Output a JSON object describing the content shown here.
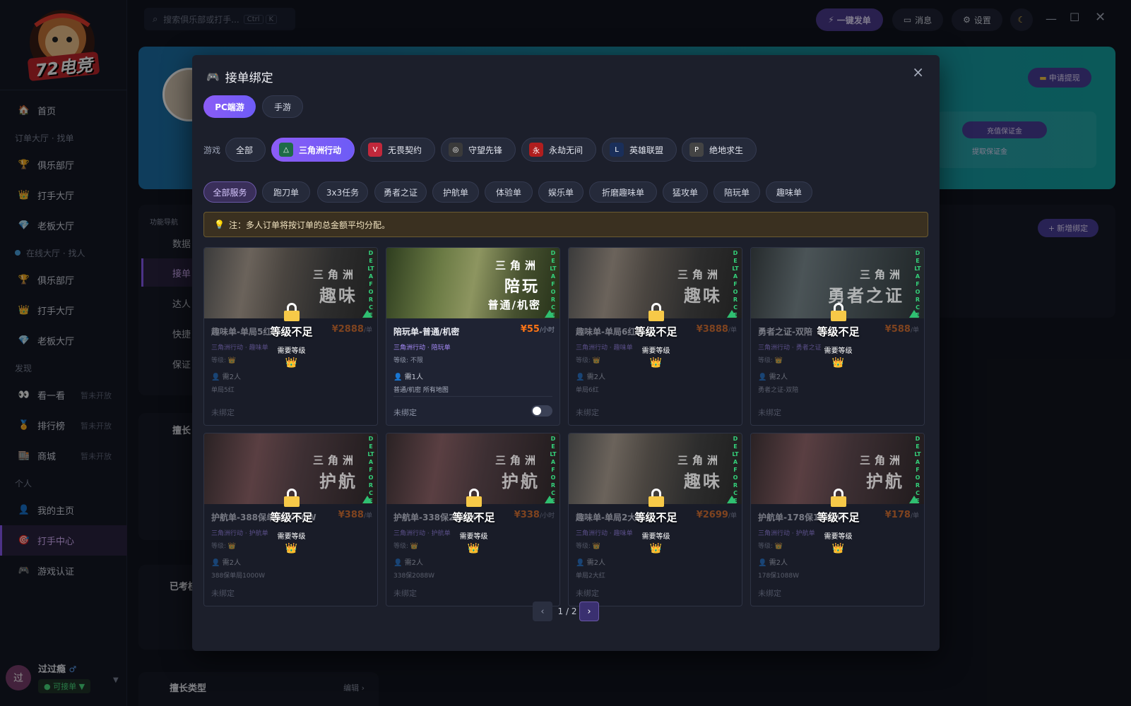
{
  "sidebar": {
    "logo_text": "72电竞",
    "sections": [
      {
        "type": "item",
        "icon": "🏠",
        "label": "首页",
        "name": "home"
      },
      {
        "type": "section",
        "label": "订单大厅 · 找单"
      },
      {
        "type": "item",
        "icon": "🏆",
        "label": "俱乐部厅",
        "name": "club-hall-orders"
      },
      {
        "type": "item",
        "icon": "👑",
        "label": "打手大厅",
        "name": "player-hall-orders"
      },
      {
        "type": "item",
        "icon": "💎",
        "label": "老板大厅",
        "name": "boss-hall-orders"
      },
      {
        "type": "section",
        "label": "在线大厅 · 找人",
        "dot": true
      },
      {
        "type": "item",
        "icon": "🏆",
        "label": "俱乐部厅",
        "name": "club-hall-online"
      },
      {
        "type": "item",
        "icon": "👑",
        "label": "打手大厅",
        "name": "player-hall-online"
      },
      {
        "type": "item",
        "icon": "💎",
        "label": "老板大厅",
        "name": "boss-hall-online"
      },
      {
        "type": "section",
        "label": "发现"
      },
      {
        "type": "item",
        "icon": "👀",
        "label": "看一看",
        "soon": "暂未开放",
        "name": "browse"
      },
      {
        "type": "item",
        "icon": "🏅",
        "label": "排行榜",
        "soon": "暂未开放",
        "name": "ranking"
      },
      {
        "type": "item",
        "icon": "🏬",
        "label": "商城",
        "soon": "暂未开放",
        "name": "mall"
      },
      {
        "type": "section",
        "label": "个人"
      },
      {
        "type": "item",
        "icon": "👤",
        "label": "我的主页",
        "name": "my-home"
      },
      {
        "type": "item",
        "icon": "🎯",
        "label": "打手中心",
        "active": true,
        "name": "player-center"
      },
      {
        "type": "item",
        "icon": "🎮",
        "label": "游戏认证",
        "name": "game-auth"
      }
    ],
    "user": {
      "avatar": "过",
      "name": "过过瘾",
      "gender": "♂",
      "status": "● 可接单 ▼"
    }
  },
  "topbar": {
    "search_placeholder": "搜索俱乐部或打手...",
    "shortcut": [
      "Ctrl",
      "K"
    ],
    "quick_order": "一键发单",
    "messages": "消息",
    "settings": "设置"
  },
  "background": {
    "apply_withdraw": "申请提现",
    "recharge_deposit": "充值保证金",
    "withdraw_deposit": "提取保证金",
    "function_nav": "功能导航",
    "nav_items": [
      "数据",
      "接单",
      "达人",
      "快捷",
      "保证"
    ],
    "add_binding": "新增绑定",
    "skills_title": "擅长",
    "passed_title": "已考核",
    "skill_types": "擅长类型",
    "edit": "编辑 ›"
  },
  "modal": {
    "title": "接单绑定",
    "platforms": [
      "PC端游",
      "手游"
    ],
    "game_label": "游戏",
    "games": [
      {
        "label": "全部",
        "icon": "",
        "name": "all"
      },
      {
        "label": "三角洲行动",
        "icon": "△",
        "color": "#1e6b47",
        "active": true,
        "name": "delta-force"
      },
      {
        "label": "无畏契约",
        "icon": "V",
        "color": "#c2283b",
        "name": "valorant"
      },
      {
        "label": "守望先锋",
        "icon": "◎",
        "color": "#3a3a3a",
        "name": "overwatch"
      },
      {
        "label": "永劫无间",
        "icon": "永",
        "color": "#b01e1e",
        "name": "naraka"
      },
      {
        "label": "英雄联盟",
        "icon": "L",
        "color": "#1a2f5a",
        "name": "lol"
      },
      {
        "label": "绝地求生",
        "icon": "P",
        "color": "#444444",
        "name": "pubg"
      }
    ],
    "services": [
      "全部服务",
      "跑刀单",
      "3x3任务",
      "勇者之证",
      "护航单",
      "体验单",
      "娱乐单",
      "折磨趣味单",
      "猛攻单",
      "陪玩单",
      "趣味单"
    ],
    "note": "注：多人订单将按订单的总金额平均分配。",
    "lock_title": "等级不足",
    "lock_sub": "需要等级",
    "lock_crown": "👑",
    "cards": [
      {
        "b_top": "三角洲",
        "b_big": "趣味",
        "b_sub": "",
        "name": "趣味单-单局5红",
        "price": "¥2888",
        "unit": "/单",
        "tags": "三角洲行动 · 趣味单",
        "level": "等级: 👑",
        "people": "需2人",
        "desc": "单局5红",
        "bind": "未绑定",
        "locked": true,
        "art": "a"
      },
      {
        "b_top": "三角洲",
        "b_big": "陪玩",
        "b_sub": "普通/机密",
        "name": "陪玩单-普通/机密",
        "price": "¥55",
        "unit": "/小时",
        "tags": "三角洲行动 · 陪玩单",
        "level": "等级: 不限",
        "people": "需1人",
        "desc": "普通/机密 所有地图",
        "bind": "未绑定",
        "locked": false,
        "art": "b"
      },
      {
        "b_top": "三角洲",
        "b_big": "趣味",
        "b_sub": "",
        "name": "趣味单-单局6红",
        "price": "¥3888",
        "unit": "/单",
        "tags": "三角洲行动 · 趣味单",
        "level": "等级: 👑",
        "people": "需2人",
        "desc": "单局6红",
        "bind": "未绑定",
        "locked": true,
        "art": "a"
      },
      {
        "b_top": "三角洲",
        "b_big": "勇者之证",
        "b_sub": "",
        "name": "勇者之证-双陪",
        "price": "¥588",
        "unit": "/单",
        "tags": "三角洲行动 · 勇者之证",
        "level": "等级: 👑",
        "people": "需2人",
        "desc": "勇者之证-双陪",
        "bind": "未绑定",
        "locked": true,
        "art": "c"
      },
      {
        "b_top": "三角洲",
        "b_big": "护航",
        "b_sub": "",
        "name": "护航单-388保单局1000W",
        "price": "¥388",
        "unit": "/单",
        "tags": "三角洲行动 · 护航单",
        "level": "等级: 👑",
        "people": "需2人",
        "desc": "388保单局1000W",
        "bind": "未绑定",
        "locked": true,
        "art": "d"
      },
      {
        "b_top": "三角洲",
        "b_big": "护航",
        "b_sub": "",
        "name": "护航单-338保2088W",
        "price": "¥338",
        "unit": "/小时",
        "tags": "三角洲行动 · 护航单",
        "level": "等级: 👑",
        "people": "需2人",
        "desc": "338保2088W",
        "bind": "未绑定",
        "locked": true,
        "art": "d"
      },
      {
        "b_top": "三角洲",
        "b_big": "趣味",
        "b_sub": "",
        "name": "趣味单-单局2大红",
        "price": "¥2699",
        "unit": "/单",
        "tags": "三角洲行动 · 趣味单",
        "level": "等级: 👑",
        "people": "需2人",
        "desc": "单局2大红",
        "bind": "未绑定",
        "locked": true,
        "art": "a"
      },
      {
        "b_top": "三角洲",
        "b_big": "护航",
        "b_sub": "",
        "name": "护航单-178保1088W",
        "price": "¥178",
        "unit": "/单",
        "tags": "三角洲行动 · 护航单",
        "level": "等级: 👑",
        "people": "需2人",
        "desc": "178保1088W",
        "bind": "未绑定",
        "locked": true,
        "art": "d"
      }
    ],
    "banner_vertical": "DELTAFORCE",
    "pagination": {
      "prev": "‹",
      "text": "1 / 2",
      "next": "›"
    }
  }
}
